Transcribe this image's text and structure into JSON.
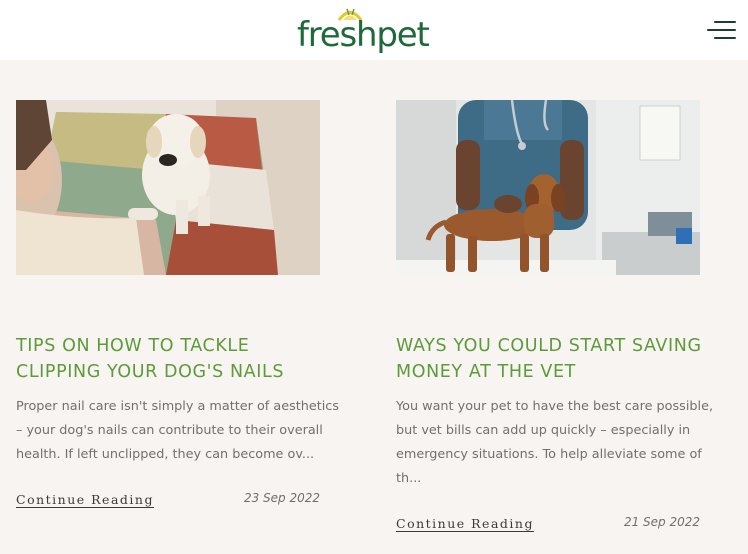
{
  "header": {
    "logo_text": "freshpet",
    "menu_icon": "hamburger-menu-icon"
  },
  "colors": {
    "brand_green": "#1f6a3a",
    "title_green": "#5d9b3a",
    "background": "#f8f4f1",
    "sun_yellow": "#e2c82a"
  },
  "articles": [
    {
      "title_lines": [
        "TIPS ON HOW TO TACKLE",
        "CLIPPING YOUR DOG'S NAILS"
      ],
      "excerpt_lines": [
        "Proper nail care isn't simply a matter of aesthetics",
        "– your dog's nails can contribute to their overall",
        "health. If left unclipped, they can become ov..."
      ],
      "link_label": "Continue Reading",
      "date": "23 Sep 2022"
    },
    {
      "title_lines": [
        "WAYS YOU COULD START SAVING",
        "MONEY AT THE VET"
      ],
      "excerpt_lines": [
        "You want your pet to have the best care possible,",
        "but vet bills can add up quickly – especially in",
        "emergency situations. To help alleviate some of",
        "th..."
      ],
      "link_label": "Continue Reading",
      "date": "21 Sep 2022"
    }
  ]
}
